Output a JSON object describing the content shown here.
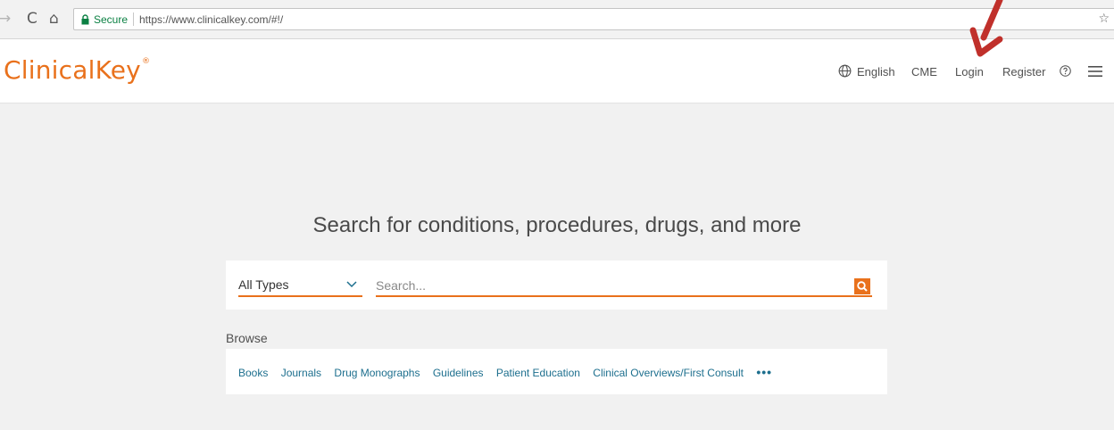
{
  "browser": {
    "nav_forward": "→",
    "nav_reload": "C",
    "nav_home": "⌂",
    "secure_label": "Secure",
    "url": "https://www.clinicalkey.com/#!/",
    "star": "☆"
  },
  "header": {
    "logo": "ClinicalKey",
    "logo_mark": "®",
    "language": "English",
    "cme": "CME",
    "login": "Login",
    "register": "Register",
    "icons": [
      "globe-icon",
      "help-icon",
      "menu-icon"
    ]
  },
  "main": {
    "headline": "Search for conditions, procedures, drugs, and more",
    "type_select": "All Types",
    "search_placeholder": "Search...",
    "browse_label": "Browse",
    "browse_links": [
      "Books",
      "Journals",
      "Drug Monographs",
      "Guidelines",
      "Patient Education",
      "Clinical Overviews/First Consult"
    ],
    "more": "•••"
  },
  "colors": {
    "brand_orange": "#e9711c",
    "link_blue": "#1d6f8e",
    "annotation_red": "#c0302b"
  }
}
